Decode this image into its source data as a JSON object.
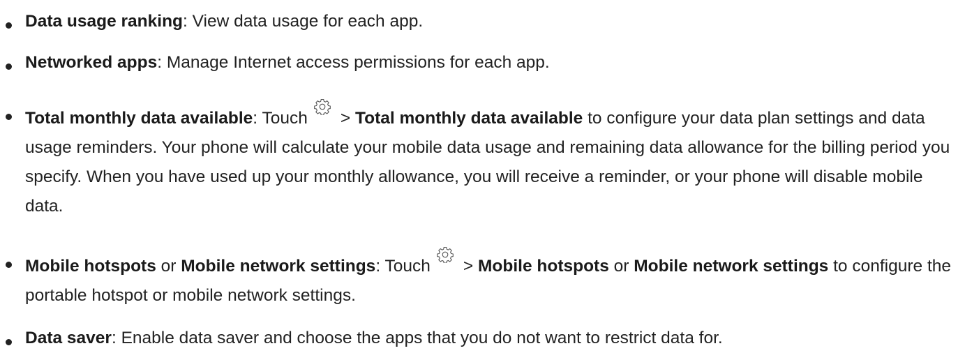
{
  "items": [
    {
      "term": "Data usage ranking",
      "desc": ": View data usage for each app."
    },
    {
      "term": "Networked apps",
      "desc": ": Manage Internet access permissions for each app."
    },
    {
      "term": "Total monthly data available",
      "mid": ": Touch",
      "icon": "gear-icon",
      "arrow": ">",
      "action": "Total monthly data available",
      "desc": "to configure your data plan settings and data usage reminders. Your phone will calculate your mobile data usage and remaining data allowance for the billing period you specify. When you have used up your monthly allowance, you will receive a reminder, or your phone will disable mobile data."
    },
    {
      "term": "Mobile hotspots",
      "or1": "or",
      "term2": "Mobile network settings",
      "mid": ": Touch",
      "icon": "gear-icon",
      "arrow": ">",
      "action": "Mobile hotspots",
      "or2": "or",
      "action2": "Mobile network settings",
      "desc": "to configure the portable hotspot or mobile network settings."
    },
    {
      "term": "Data saver",
      "desc": ": Enable data saver and choose the apps that you do not want to restrict data for."
    }
  ]
}
